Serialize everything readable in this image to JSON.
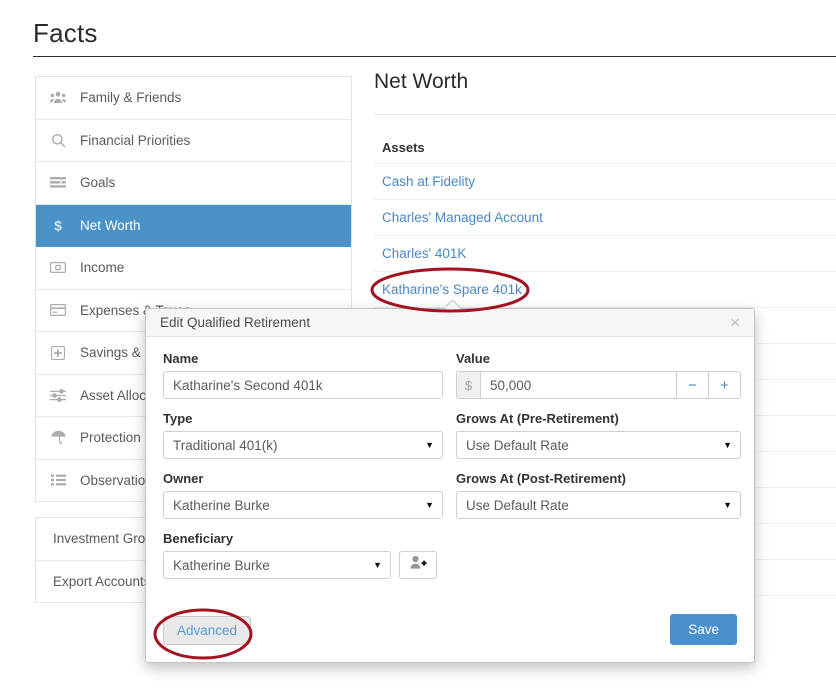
{
  "page": {
    "title": "Facts"
  },
  "sidebar": {
    "items": [
      {
        "label": "Family & Friends",
        "icon": "people-group-icon",
        "active": false
      },
      {
        "label": "Financial Priorities",
        "icon": "search-icon",
        "active": false
      },
      {
        "label": "Goals",
        "icon": "list-bars-icon",
        "active": false
      },
      {
        "label": "Net Worth",
        "icon": "dollar-icon",
        "active": true
      },
      {
        "label": "Income",
        "icon": "money-bill-icon",
        "active": false
      },
      {
        "label": "Expenses & Taxes",
        "icon": "credit-card-icon",
        "active": false
      },
      {
        "label": "Savings & Contributions",
        "icon": "plus-square-icon",
        "active": false
      },
      {
        "label": "Asset Allocation",
        "icon": "sliders-icon",
        "active": false
      },
      {
        "label": "Protection",
        "icon": "umbrella-icon",
        "active": false
      },
      {
        "label": "Observations",
        "icon": "list-ul-icon",
        "active": false
      }
    ],
    "sub_items": [
      {
        "label": "Investment Groups"
      },
      {
        "label": "Export Accounts"
      }
    ]
  },
  "panel": {
    "title": "Net Worth",
    "section_header": "Assets",
    "assets": [
      {
        "name": "Cash at Fidelity"
      },
      {
        "name": "Charles' Managed Account"
      },
      {
        "name": "Charles' 401K"
      },
      {
        "name": "Katharine's Spare 401k"
      }
    ],
    "empty_rows": 9
  },
  "modal": {
    "title": "Edit Qualified Retirement",
    "close_icon": "close-icon",
    "fields": {
      "name_label": "Name",
      "name_value": "Katharine's Second 401k",
      "type_label": "Type",
      "type_value": "Traditional 401(k)",
      "owner_label": "Owner",
      "owner_value": "Katherine Burke",
      "beneficiary_label": "Beneficiary",
      "beneficiary_value": "Katherine Burke",
      "add_person_icon": "add-person-icon",
      "value_label": "Value",
      "value_currency": "$",
      "value_amount": "50,000",
      "stepper_minus": "−",
      "stepper_plus": "+",
      "pre_retirement_label": "Grows At (Pre-Retirement)",
      "pre_retirement_value": "Use Default Rate",
      "post_retirement_label": "Grows At (Post-Retirement)",
      "post_retirement_value": "Use Default Rate"
    },
    "advanced_label": "Advanced",
    "save_label": "Save",
    "caret_glyph": "▼"
  },
  "colors": {
    "accent_blue": "#4a90cd",
    "active_row": "#4a92c8",
    "link_blue": "#4a87c4",
    "annotation_red": "#a31220"
  }
}
